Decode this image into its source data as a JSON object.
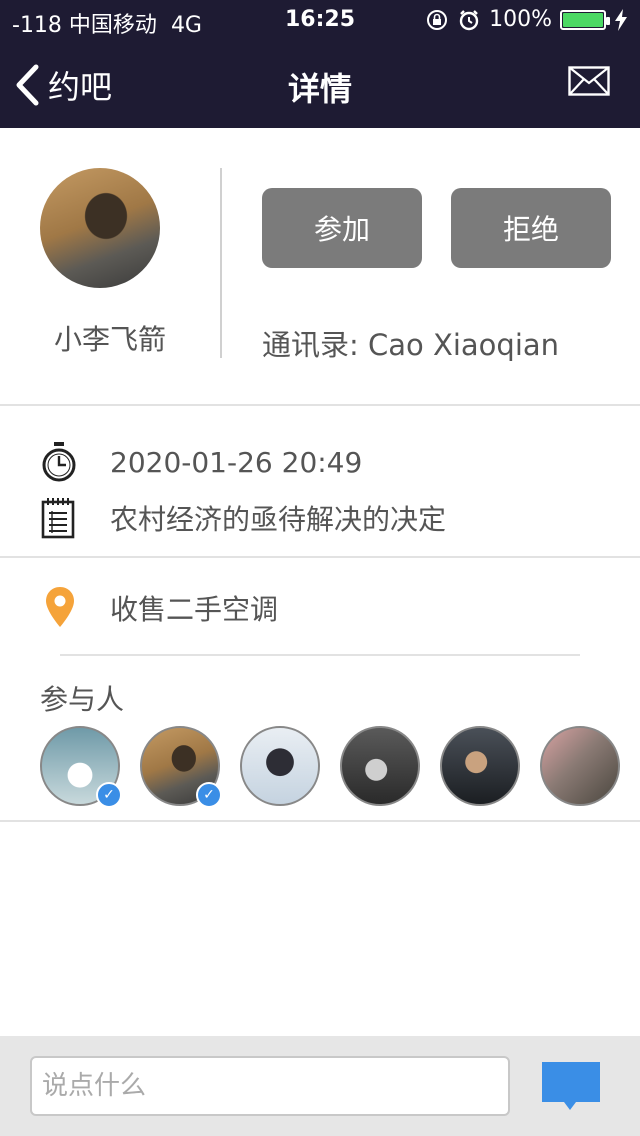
{
  "status_bar": {
    "carrier": "-118 中国移动",
    "network": "4G",
    "time": "16:25",
    "battery": "100%",
    "battery_level": 1.0
  },
  "nav": {
    "back_label": "约吧",
    "title": "详情"
  },
  "profile": {
    "username": "小李飞箭",
    "join_label": "参加",
    "reject_label": "拒绝",
    "contact": "通讯录: Cao Xiaoqian"
  },
  "event": {
    "datetime": "2020-01-26 20:49",
    "description": "农村经济的亟待解决的决定",
    "location": "收售二手空调"
  },
  "participants": {
    "title": "参与人",
    "count": 6,
    "verified": [
      true,
      true,
      false,
      false,
      false,
      false
    ]
  },
  "comment": {
    "placeholder": "说点什么"
  },
  "colors": {
    "header_bg": "#1e1b33",
    "button_bg": "#7b7b7b",
    "accent_blue": "#3a8ee6",
    "location_orange": "#f5a33a"
  }
}
